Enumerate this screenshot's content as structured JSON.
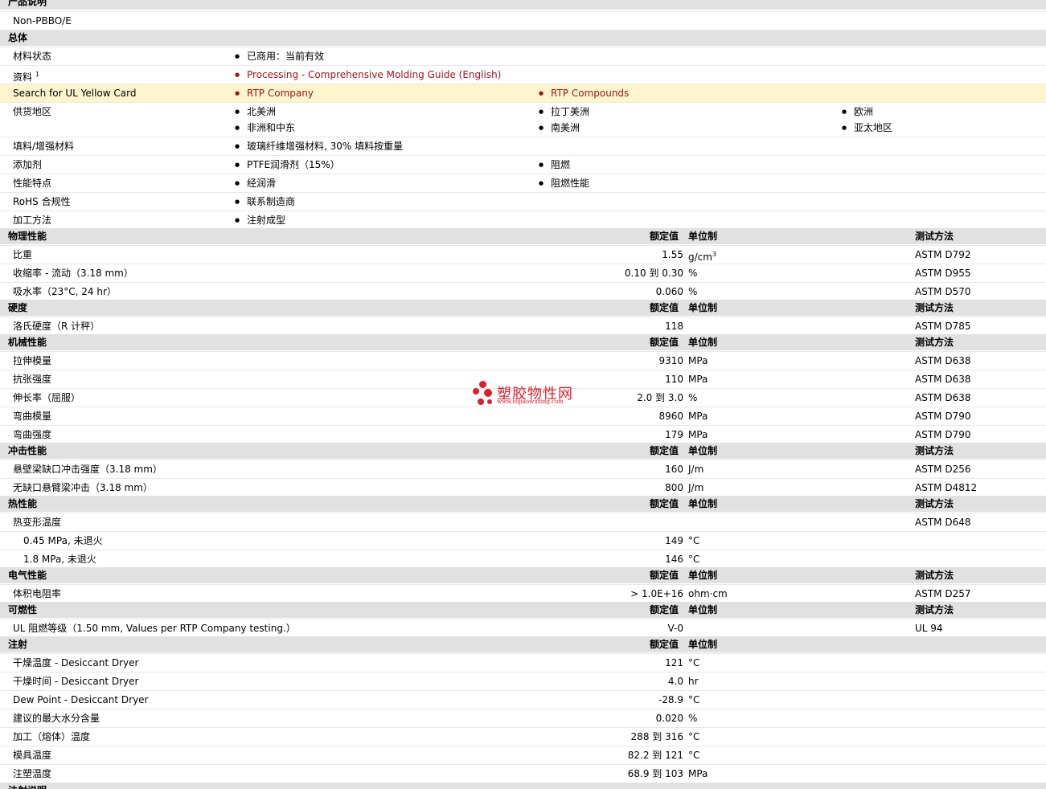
{
  "product_desc": {
    "title": "产品说明",
    "value": "Non-PBBO/E"
  },
  "general": {
    "title": "总体",
    "material_status": {
      "label": "材料状态",
      "value": "已商用：当前有效"
    },
    "docs": {
      "label": "资料",
      "sup": "1",
      "link": "Processing - Comprehensive Molding Guide (English)"
    },
    "ul": {
      "label": "Search for UL Yellow Card",
      "link1": "RTP Company",
      "link2": "RTP Compounds"
    },
    "supply": {
      "label": "供货地区",
      "items": [
        "北美洲",
        "拉丁美洲",
        "欧洲",
        "非洲和中东",
        "南美洲",
        "亚太地区"
      ]
    },
    "filler": {
      "label": "填料/增强材料",
      "value": "玻璃纤维增强材料, 30% 填料按重量"
    },
    "additive": {
      "label": "添加剂",
      "v1": "PTFE润滑剂（15%）",
      "v2": "阻燃"
    },
    "features": {
      "label": "性能特点",
      "v1": "经润滑",
      "v2": "阻燃性能"
    },
    "rohs": {
      "label": "RoHS 合规性",
      "value": "联系制造商"
    },
    "processing": {
      "label": "加工方法",
      "value": "注射成型"
    }
  },
  "headers": {
    "rated": "额定值",
    "unit": "单位制",
    "test": "测试方法"
  },
  "physical": {
    "title": "物理性能",
    "rows": [
      {
        "label": "比重",
        "value": "1.55",
        "unit": "g/cm",
        "unit_sup": "3",
        "test": "ASTM D792"
      },
      {
        "label": "收缩率 - 流动（3.18 mm）",
        "value": "0.10 到 0.30",
        "unit": "%",
        "test": "ASTM D955"
      },
      {
        "label": "吸水率（23°C, 24 hr）",
        "value": "0.060",
        "unit": "%",
        "test": "ASTM D570"
      }
    ]
  },
  "hardness": {
    "title": "硬度",
    "rows": [
      {
        "label": "洛氏硬度（R 计秤）",
        "value": "118",
        "unit": "",
        "test": "ASTM D785"
      }
    ]
  },
  "mechanical": {
    "title": "机械性能",
    "rows": [
      {
        "label": "拉伸模量",
        "value": "9310",
        "unit": "MPa",
        "test": "ASTM D638"
      },
      {
        "label": "抗张强度",
        "value": "110",
        "unit": "MPa",
        "test": "ASTM D638"
      },
      {
        "label": "伸长率（屈服）",
        "value": "2.0 到 3.0",
        "unit": "%",
        "test": "ASTM D638"
      },
      {
        "label": "弯曲模量",
        "value": "8960",
        "unit": "MPa",
        "test": "ASTM D790"
      },
      {
        "label": "弯曲强度",
        "value": "179",
        "unit": "MPa",
        "test": "ASTM D790"
      }
    ]
  },
  "impact": {
    "title": "冲击性能",
    "rows": [
      {
        "label": "悬壁梁缺口冲击强度（3.18 mm）",
        "value": "160",
        "unit": "J/m",
        "test": "ASTM D256"
      },
      {
        "label": "无缺口悬臂梁冲击（3.18 mm）",
        "value": "800",
        "unit": "J/m",
        "test": "ASTM D4812"
      }
    ]
  },
  "thermal": {
    "title": "热性能",
    "rows": [
      {
        "label": "热变形温度",
        "value": "",
        "unit": "",
        "test": "ASTM D648"
      },
      {
        "label": "0.45 MPa, 未退火",
        "value": "149",
        "unit": "°C",
        "test": ""
      },
      {
        "label": "1.8 MPa, 未退火",
        "value": "146",
        "unit": "°C",
        "test": ""
      }
    ]
  },
  "electrical": {
    "title": "电气性能",
    "rows": [
      {
        "label": "体积电阻率",
        "value": "> 1.0E+16",
        "unit": "ohm·cm",
        "test": "ASTM D257"
      }
    ]
  },
  "flammability": {
    "title": "可燃性",
    "rows": [
      {
        "label": "UL 阻燃等级（1.50 mm, Values per RTP Company testing.）",
        "value": "V-0",
        "unit": "",
        "test": "UL 94"
      }
    ]
  },
  "injection": {
    "title": "注射",
    "rows": [
      {
        "label": "干燥温度 - Desiccant Dryer",
        "value": "121",
        "unit": "°C"
      },
      {
        "label": "干燥时间 - Desiccant Dryer",
        "value": "4.0",
        "unit": "hr"
      },
      {
        "label": "Dew Point - Desiccant Dryer",
        "value": "-28.9",
        "unit": "°C"
      },
      {
        "label": "建议的最大水分含量",
        "value": "0.020",
        "unit": "%"
      },
      {
        "label": "加工（熔体）温度",
        "value": "288 到 316",
        "unit": "°C"
      },
      {
        "label": "模具温度",
        "value": "82.2 到 121",
        "unit": "°C"
      },
      {
        "label": "注塑温度",
        "value": "68.9 到 103",
        "unit": "MPa"
      }
    ]
  },
  "injection_notes": {
    "title": "注射说明"
  },
  "watermark": {
    "text": "塑胶物性网",
    "sub": "www.sujiaowuxing.com"
  }
}
